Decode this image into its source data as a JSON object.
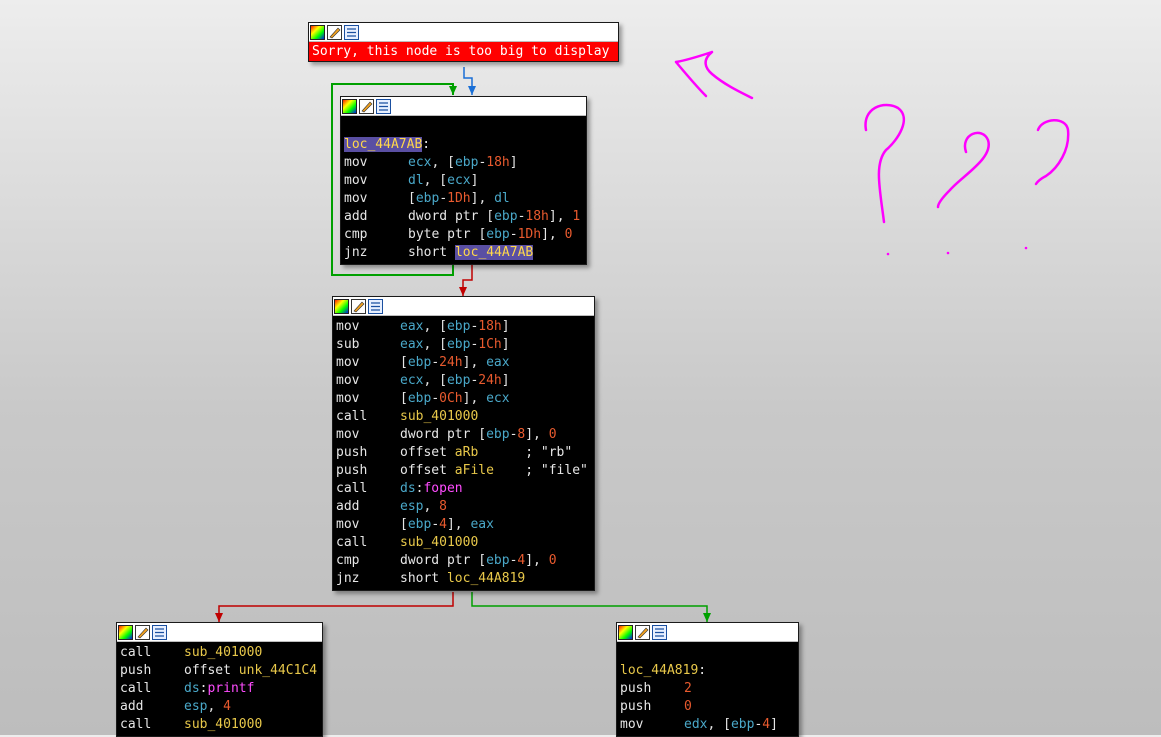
{
  "colors": {
    "edge_true": "#00a000",
    "edge_false": "#c00000",
    "edge_unconditional": "#1a6fd6",
    "annotation": "#ff00ff",
    "mnemonic": "#e6e6e6",
    "register": "#4aa8c9",
    "number": "#e85a2e",
    "symbol": "#e8c84a",
    "import": "#ff4cff",
    "highlight_bg": "#5a4fa3",
    "error_bg": "#ff0000"
  },
  "header_icons": [
    "node-color-icon",
    "rename-node-icon",
    "graph-overview-icon"
  ],
  "nodes": [
    {
      "id": "node-top",
      "error": "Sorry, this node is too big to display",
      "lines": []
    },
    {
      "id": "node-loop",
      "lines": [
        [],
        [
          {
            "t": "loc_44A7AB",
            "c": "hl"
          },
          {
            "t": ":",
            "c": "plain"
          }
        ],
        [
          {
            "m": "mov"
          },
          {
            "t": "ecx",
            "c": "reg"
          },
          {
            "t": ", [",
            "c": "plain"
          },
          {
            "t": "ebp",
            "c": "reg"
          },
          {
            "t": "-",
            "c": "plain"
          },
          {
            "t": "18h",
            "c": "num"
          },
          {
            "t": "]",
            "c": "plain"
          }
        ],
        [
          {
            "m": "mov"
          },
          {
            "t": "dl",
            "c": "reg"
          },
          {
            "t": ", [",
            "c": "plain"
          },
          {
            "t": "ecx",
            "c": "reg"
          },
          {
            "t": "]",
            "c": "plain"
          }
        ],
        [
          {
            "m": "mov"
          },
          {
            "t": "[",
            "c": "plain"
          },
          {
            "t": "ebp",
            "c": "reg"
          },
          {
            "t": "-",
            "c": "plain"
          },
          {
            "t": "1Dh",
            "c": "num"
          },
          {
            "t": "], ",
            "c": "plain"
          },
          {
            "t": "dl",
            "c": "reg"
          }
        ],
        [
          {
            "m": "add"
          },
          {
            "t": "dword ptr [",
            "c": "plain"
          },
          {
            "t": "ebp",
            "c": "reg"
          },
          {
            "t": "-",
            "c": "plain"
          },
          {
            "t": "18h",
            "c": "num"
          },
          {
            "t": "], ",
            "c": "plain"
          },
          {
            "t": "1",
            "c": "num"
          }
        ],
        [
          {
            "m": "cmp"
          },
          {
            "t": "byte ptr [",
            "c": "plain"
          },
          {
            "t": "ebp",
            "c": "reg"
          },
          {
            "t": "-",
            "c": "plain"
          },
          {
            "t": "1Dh",
            "c": "num"
          },
          {
            "t": "], ",
            "c": "plain"
          },
          {
            "t": "0",
            "c": "num"
          }
        ],
        [
          {
            "m": "jnz"
          },
          {
            "t": "short ",
            "c": "plain"
          },
          {
            "t": "loc_44A7AB",
            "c": "hl"
          }
        ]
      ]
    },
    {
      "id": "node-main",
      "lines": [
        [
          {
            "m": "mov"
          },
          {
            "t": "eax",
            "c": "reg"
          },
          {
            "t": ", [",
            "c": "plain"
          },
          {
            "t": "ebp",
            "c": "reg"
          },
          {
            "t": "-",
            "c": "plain"
          },
          {
            "t": "18h",
            "c": "num"
          },
          {
            "t": "]",
            "c": "plain"
          }
        ],
        [
          {
            "m": "sub"
          },
          {
            "t": "eax",
            "c": "reg"
          },
          {
            "t": ", [",
            "c": "plain"
          },
          {
            "t": "ebp",
            "c": "reg"
          },
          {
            "t": "-",
            "c": "plain"
          },
          {
            "t": "1Ch",
            "c": "num"
          },
          {
            "t": "]",
            "c": "plain"
          }
        ],
        [
          {
            "m": "mov"
          },
          {
            "t": "[",
            "c": "plain"
          },
          {
            "t": "ebp",
            "c": "reg"
          },
          {
            "t": "-",
            "c": "plain"
          },
          {
            "t": "24h",
            "c": "num"
          },
          {
            "t": "], ",
            "c": "plain"
          },
          {
            "t": "eax",
            "c": "reg"
          }
        ],
        [
          {
            "m": "mov"
          },
          {
            "t": "ecx",
            "c": "reg"
          },
          {
            "t": ", [",
            "c": "plain"
          },
          {
            "t": "ebp",
            "c": "reg"
          },
          {
            "t": "-",
            "c": "plain"
          },
          {
            "t": "24h",
            "c": "num"
          },
          {
            "t": "]",
            "c": "plain"
          }
        ],
        [
          {
            "m": "mov"
          },
          {
            "t": "[",
            "c": "plain"
          },
          {
            "t": "ebp",
            "c": "reg"
          },
          {
            "t": "-",
            "c": "plain"
          },
          {
            "t": "0Ch",
            "c": "num"
          },
          {
            "t": "], ",
            "c": "plain"
          },
          {
            "t": "ecx",
            "c": "reg"
          }
        ],
        [
          {
            "m": "call"
          },
          {
            "t": "sub_401000",
            "c": "sym"
          }
        ],
        [
          {
            "m": "mov"
          },
          {
            "t": "dword ptr [",
            "c": "plain"
          },
          {
            "t": "ebp",
            "c": "reg"
          },
          {
            "t": "-",
            "c": "plain"
          },
          {
            "t": "8",
            "c": "num"
          },
          {
            "t": "], ",
            "c": "plain"
          },
          {
            "t": "0",
            "c": "num"
          }
        ],
        [
          {
            "m": "push"
          },
          {
            "t": "offset ",
            "c": "plain"
          },
          {
            "t": "aRb",
            "c": "sym"
          },
          {
            "t": "      ; \"rb\"",
            "c": "cmt"
          }
        ],
        [
          {
            "m": "push"
          },
          {
            "t": "offset ",
            "c": "plain"
          },
          {
            "t": "aFile",
            "c": "sym"
          },
          {
            "t": "    ; \"file\"",
            "c": "cmt"
          }
        ],
        [
          {
            "m": "call"
          },
          {
            "t": "ds",
            "c": "reg"
          },
          {
            "t": ":",
            "c": "plain"
          },
          {
            "t": "fopen",
            "c": "imp"
          }
        ],
        [
          {
            "m": "add"
          },
          {
            "t": "esp",
            "c": "reg"
          },
          {
            "t": ", ",
            "c": "plain"
          },
          {
            "t": "8",
            "c": "num"
          }
        ],
        [
          {
            "m": "mov"
          },
          {
            "t": "[",
            "c": "plain"
          },
          {
            "t": "ebp",
            "c": "reg"
          },
          {
            "t": "-",
            "c": "plain"
          },
          {
            "t": "4",
            "c": "num"
          },
          {
            "t": "], ",
            "c": "plain"
          },
          {
            "t": "eax",
            "c": "reg"
          }
        ],
        [
          {
            "m": "call"
          },
          {
            "t": "sub_401000",
            "c": "sym"
          }
        ],
        [
          {
            "m": "cmp"
          },
          {
            "t": "dword ptr [",
            "c": "plain"
          },
          {
            "t": "ebp",
            "c": "reg"
          },
          {
            "t": "-",
            "c": "plain"
          },
          {
            "t": "4",
            "c": "num"
          },
          {
            "t": "], ",
            "c": "plain"
          },
          {
            "t": "0",
            "c": "num"
          }
        ],
        [
          {
            "m": "jnz"
          },
          {
            "t": "short ",
            "c": "plain"
          },
          {
            "t": "loc_44A819",
            "c": "sym"
          }
        ]
      ]
    },
    {
      "id": "node-left",
      "lines": [
        [
          {
            "m": "call"
          },
          {
            "t": "sub_401000",
            "c": "sym"
          }
        ],
        [
          {
            "m": "push"
          },
          {
            "t": "offset ",
            "c": "plain"
          },
          {
            "t": "unk_44C1C4",
            "c": "sym"
          }
        ],
        [
          {
            "m": "call"
          },
          {
            "t": "ds",
            "c": "reg"
          },
          {
            "t": ":",
            "c": "plain"
          },
          {
            "t": "printf",
            "c": "imp"
          }
        ],
        [
          {
            "m": "add"
          },
          {
            "t": "esp",
            "c": "reg"
          },
          {
            "t": ", ",
            "c": "plain"
          },
          {
            "t": "4",
            "c": "num"
          }
        ],
        [
          {
            "m": "call"
          },
          {
            "t": "sub_401000",
            "c": "sym"
          }
        ]
      ]
    },
    {
      "id": "node-right",
      "lines": [
        [],
        [
          {
            "t": "loc_44A819",
            "c": "lbl"
          },
          {
            "t": ":",
            "c": "plain"
          }
        ],
        [
          {
            "m": "push"
          },
          {
            "t": "2",
            "c": "num"
          }
        ],
        [
          {
            "m": "push"
          },
          {
            "t": "0",
            "c": "num"
          }
        ],
        [
          {
            "m": "mov"
          },
          {
            "t": "edx",
            "c": "reg"
          },
          {
            "t": ", [",
            "c": "plain"
          },
          {
            "t": "ebp",
            "c": "reg"
          },
          {
            "t": "-",
            "c": "plain"
          },
          {
            "t": "4",
            "c": "num"
          },
          {
            "t": "]",
            "c": "plain"
          }
        ]
      ]
    }
  ]
}
